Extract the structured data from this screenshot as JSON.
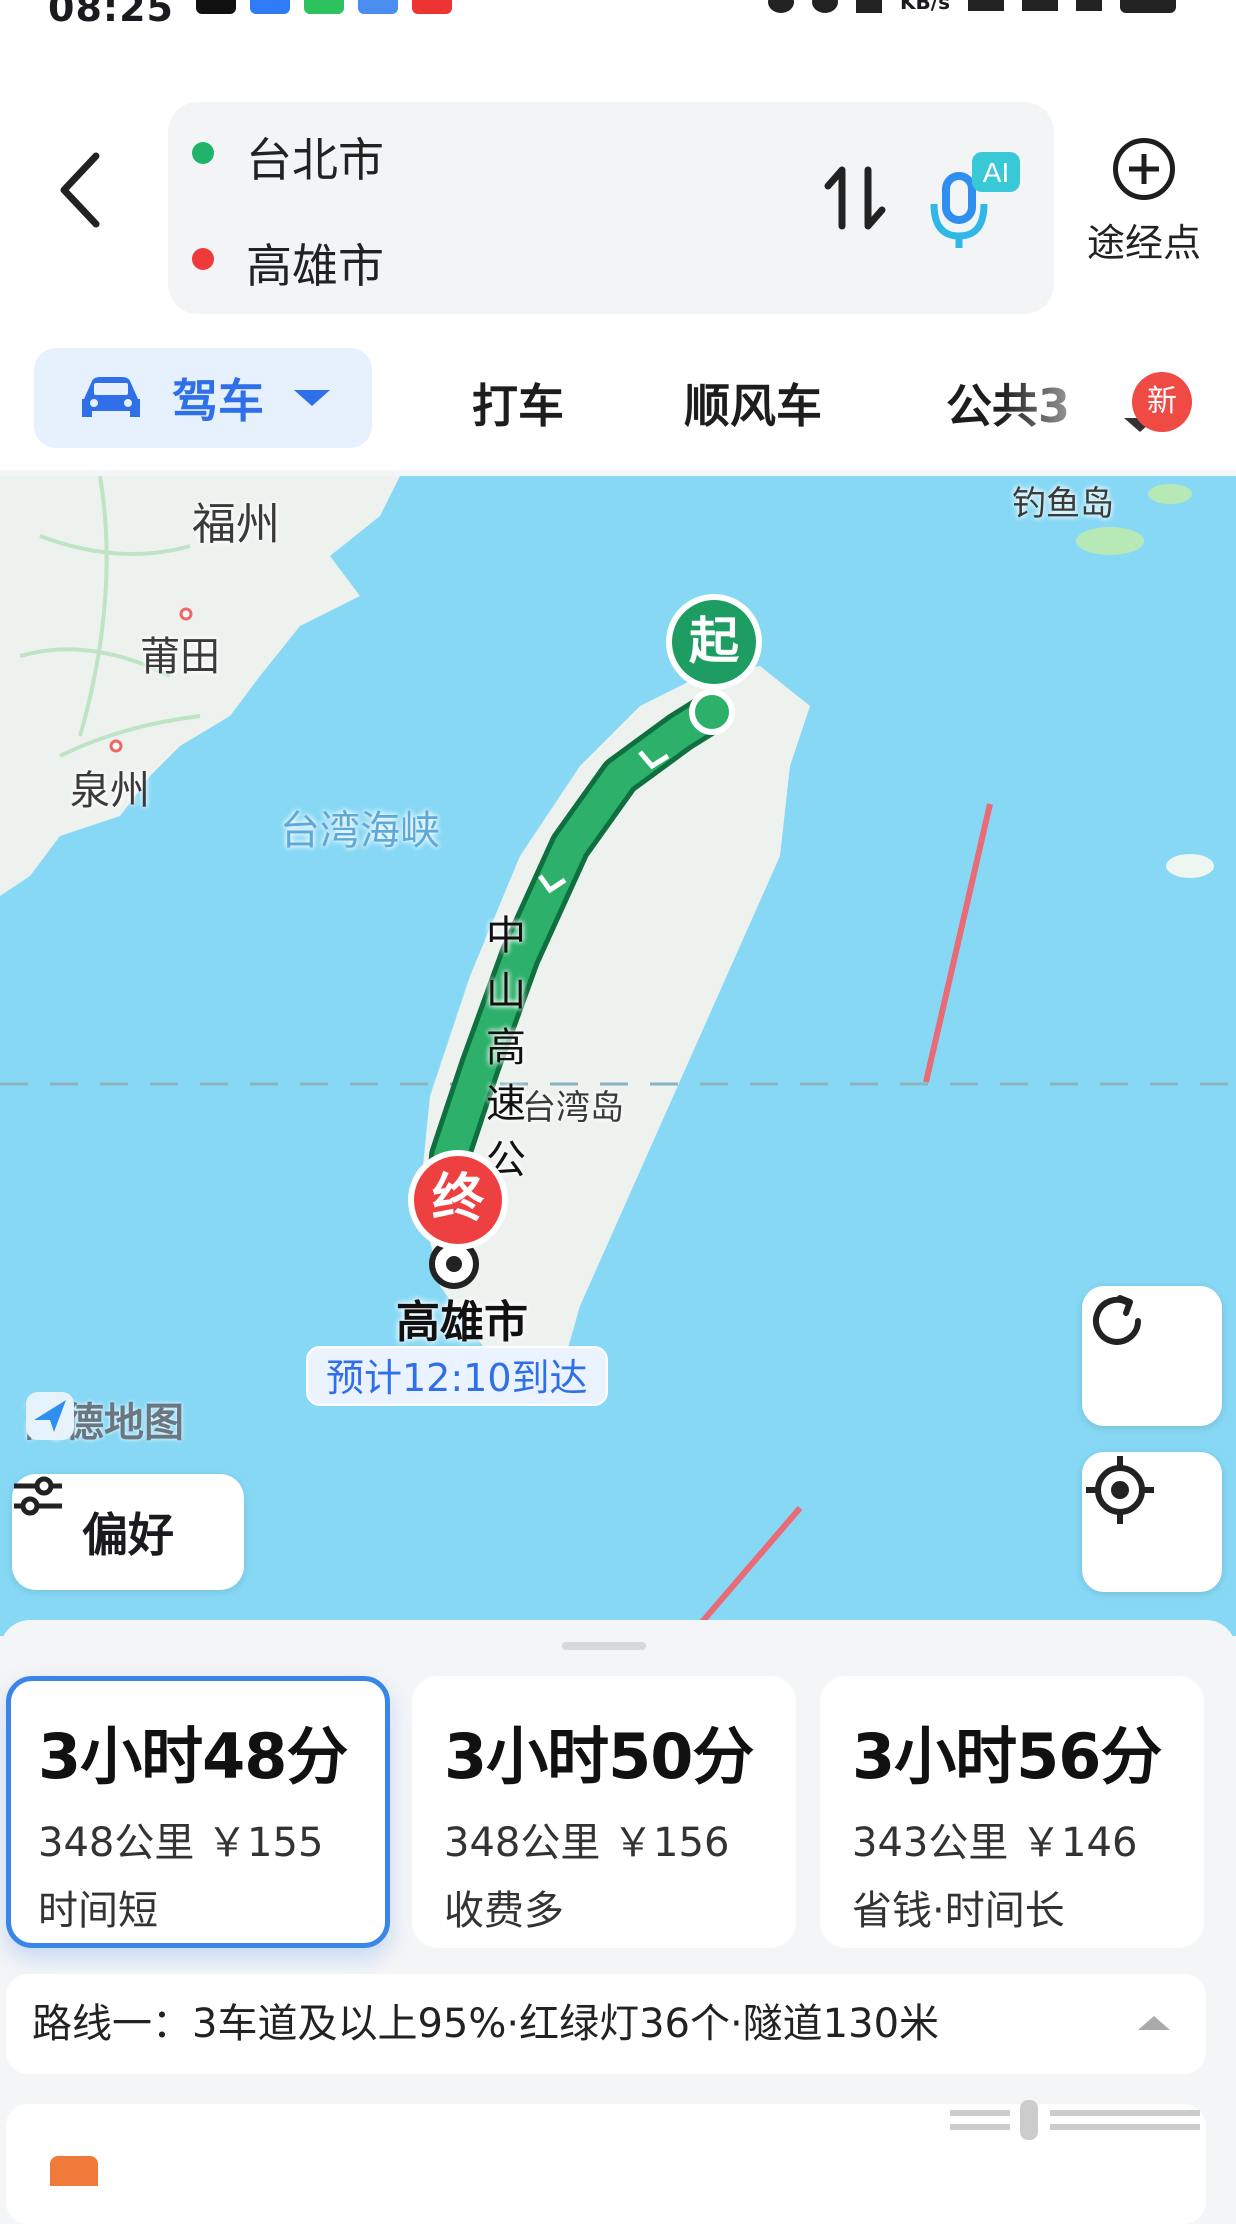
{
  "header": {
    "origin": "台北市",
    "destination": "高雄市",
    "swap_icon": "swap-vertical-icon",
    "voice_icon": "ai-mic-icon",
    "voice_badge": "AI",
    "waypoint_label": "途经点"
  },
  "modes": {
    "active_label": "驾车",
    "items": [
      "打车",
      "顺风车",
      "公共3"
    ],
    "new_badge": "新"
  },
  "map": {
    "cities": [
      "福州",
      "莆田",
      "泉州"
    ],
    "strait": "台湾海峡",
    "island": "台湾岛",
    "diaoyu": "钓鱼岛",
    "road_label": "中山高速公",
    "start_pin": "起",
    "end_pin": "终",
    "destination_label": "高雄市",
    "eta": "预计12:10到达",
    "brand": "高德地图",
    "preference_label": "偏好",
    "route_color": "#1f9b5b",
    "sea_color": "#86d8f5"
  },
  "routes": [
    {
      "time": "3小时48分",
      "info": "348公里 ￥155",
      "tag": "时间短"
    },
    {
      "time": "3小时50分",
      "info": "348公里 ￥156",
      "tag": "收费多"
    },
    {
      "time": "3小时56分",
      "info": "343公里 ￥146",
      "tag": "省钱·时间长"
    }
  ],
  "route_detail": "路线一：3车道及以上95%·红绿灯36个·隧道130米"
}
